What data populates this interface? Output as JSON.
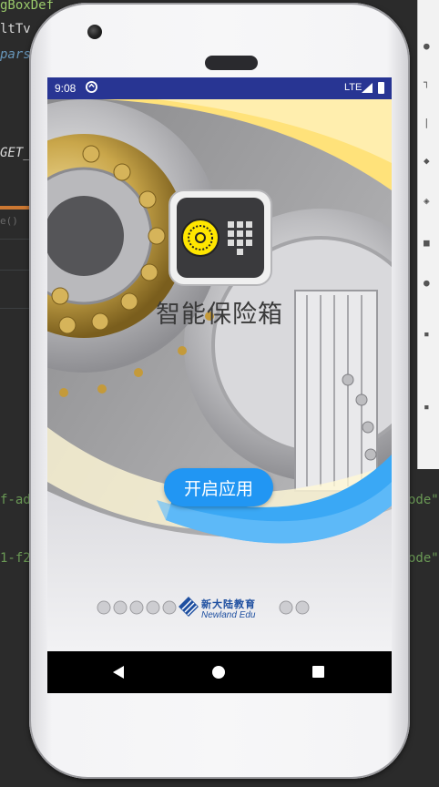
{
  "ide": {
    "lines": [
      {
        "text": "gBoxDef",
        "color": "#9aca6b"
      },
      {
        "text": "ltTv",
        "color": "#d8d8d8"
      },
      {
        "text": "pars",
        "color": "#6897bb"
      },
      {
        "text": "GET_",
        "color": "#d8d8d8"
      },
      {
        "text": "e()",
        "color": "#6b6b6b"
      },
      {
        "text": "f-ad",
        "color": "#6a9955"
      },
      {
        "text": "1-f2",
        "color": "#6a9955"
      },
      {
        "text": "ode\"",
        "color": "#6a9955"
      },
      {
        "text": "ode\"",
        "color": "#6a9955"
      }
    ]
  },
  "status_bar": {
    "time": "9:08",
    "network": "LTE",
    "icons": [
      "sync-icon",
      "signal-icon",
      "battery-icon"
    ]
  },
  "app": {
    "title": "智能保险箱",
    "open_button": "开启应用",
    "brand_cn": "新大陆教育",
    "brand_en": "Newland Edu",
    "colors": {
      "button": "#2196f3",
      "status_bar": "#283593",
      "wave_yellow": "#ffe27a",
      "wave_blue": "#3aa8f5"
    }
  },
  "nav_bar": {
    "buttons": [
      "back-icon",
      "home-icon",
      "recents-icon"
    ]
  }
}
